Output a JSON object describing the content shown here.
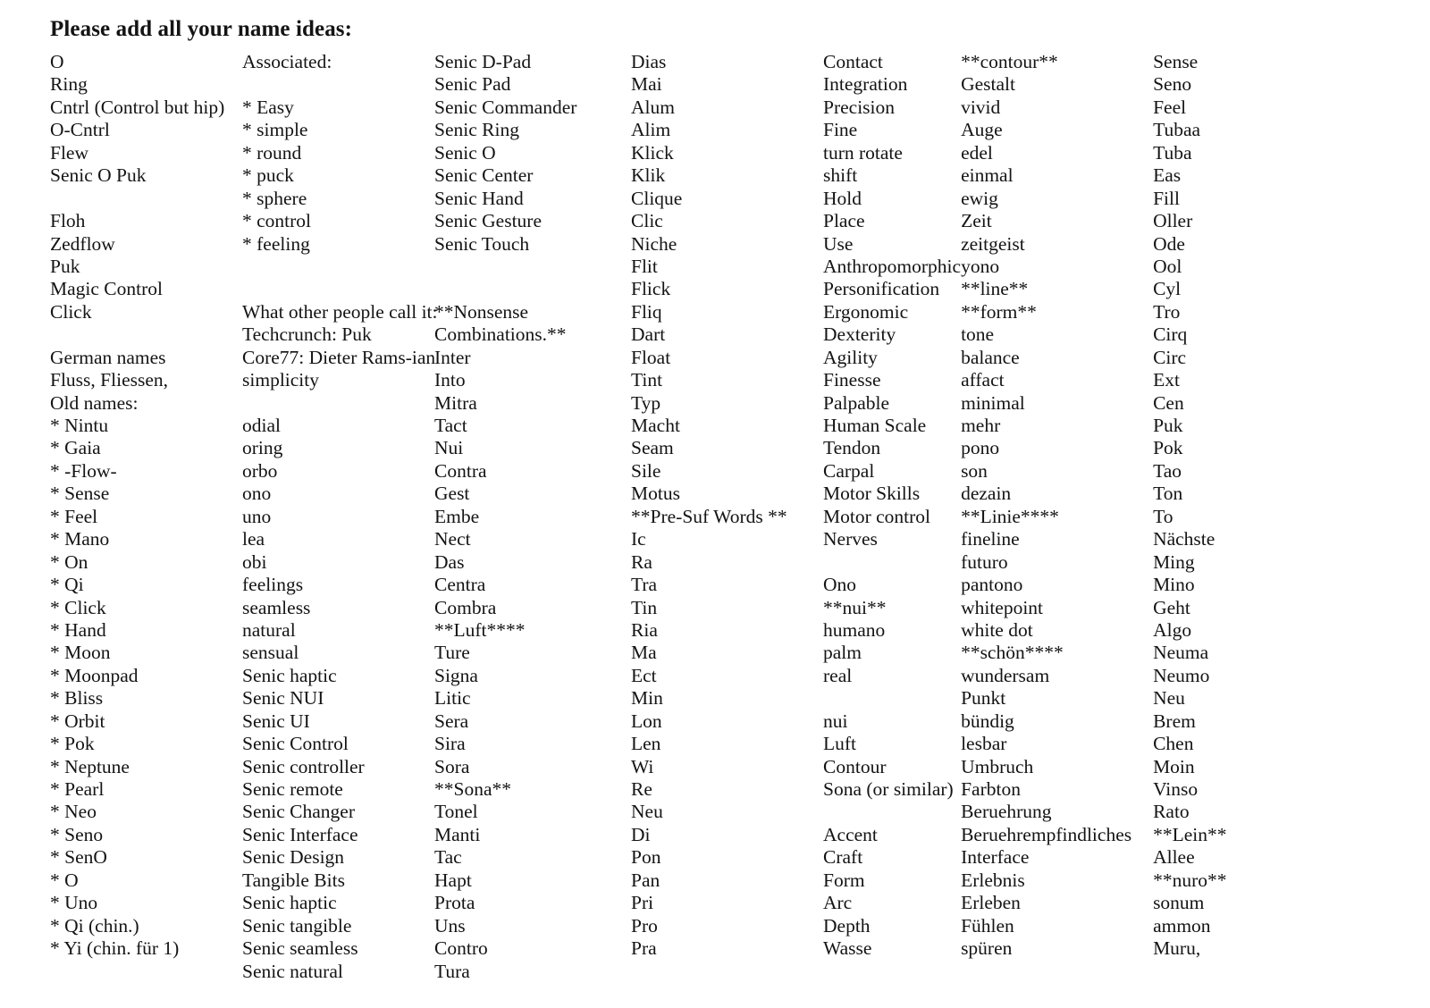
{
  "document": {
    "title": "Please add all your name ideas:"
  },
  "columns": [
    {
      "name": "column-1-core-names",
      "entries": [
        "O",
        "Ring",
        "Cntrl (Control but hip)",
        "O-Cntrl",
        "Flew",
        "Senic O Puk",
        "",
        "Floh",
        "Zedflow",
        "Puk",
        "Magic Control",
        "Click",
        "",
        "German names",
        "Fluss, Fliessen,",
        "Old names:",
        "* Nintu",
        "* Gaia",
        "* -Flow-",
        "* Sense",
        "* Feel",
        "* Mano",
        "* On",
        "* Qi",
        "* Click",
        "* Hand",
        "* Moon",
        "* Moonpad",
        "* Bliss",
        "* Orbit",
        "* Pok",
        "* Neptune",
        "* Pearl",
        "* Neo",
        "* Seno",
        "* SenO",
        "* O",
        "* Uno",
        "* Qi (chin.)",
        "* Yi (chin. für 1)"
      ]
    },
    {
      "name": "column-2-associations",
      "entries": [
        "Associated:",
        "",
        "* Easy",
        "* simple",
        "* round",
        "* puck",
        "* sphere",
        "* control",
        "* feeling",
        "",
        "",
        "What other people call it:",
        "Techcrunch: Puk",
        "Core77: Dieter Rams-ian",
        "simplicity",
        "",
        "odial",
        "oring",
        "orbo",
        "ono",
        "uno",
        "lea",
        "obi",
        "feelings",
        "seamless",
        "natural",
        "sensual",
        "Senic haptic",
        "Senic NUI",
        "Senic UI",
        "Senic Control",
        "Senic controller",
        "Senic remote",
        "Senic Changer",
        "Senic Interface",
        "Senic Design",
        "Tangible Bits",
        "Senic haptic",
        "Senic tangible",
        "Senic seamless",
        "Senic natural"
      ]
    },
    {
      "name": "column-3-senic-variants",
      "entries": [
        "Senic D-Pad",
        "Senic Pad",
        "Senic Commander",
        "Senic Ring",
        "Senic O",
        "Senic Center",
        "Senic Hand",
        "Senic Gesture",
        "Senic Touch",
        "",
        "",
        "**Nonsense",
        "Combinations.**",
        "Inter",
        "Into",
        "Mitra",
        "Tact",
        "Nui",
        "Contra",
        "Gest",
        "Embe",
        "Nect",
        "Das",
        "Centra",
        "Combra",
        "**Luft****",
        "Ture",
        "Signa",
        "Litic",
        "Sera",
        "Sira",
        "Sora",
        "**Sona**",
        "Tonel",
        "Manti",
        "Tac",
        "Hapt",
        "Prota",
        "Uns",
        "Contro",
        "Tura"
      ]
    },
    {
      "name": "column-4-short-syllables",
      "entries": [
        "Dias",
        "Mai",
        "Alum",
        "Alim",
        "Klick",
        "Klik",
        "Clique",
        "Clic",
        "Niche",
        "Flit",
        "Flick",
        "Fliq",
        "Dart",
        "Float",
        "Tint",
        "Typ",
        "Macht",
        "Seam",
        "Sile",
        "Motus",
        "**Pre-Suf Words **",
        "Ic",
        "Ra",
        "Tra",
        "Tin",
        "Ria",
        "Ma",
        "Ect",
        "Min",
        "Lon",
        "Len",
        "Wi",
        "Re",
        "Neu",
        "Di",
        "Pon",
        "Pan",
        "Pri",
        "Pro",
        "Pra"
      ]
    },
    {
      "name": "column-5-qualities",
      "entries": [
        "Contact",
        "Integration",
        "Precision",
        "Fine",
        "turn rotate",
        "shift",
        "Hold",
        "Place",
        "Use",
        "Anthropomorphic",
        "Personification",
        "Ergonomic",
        "Dexterity",
        "Agility",
        "Finesse",
        "Palpable",
        "Human Scale",
        "Tendon",
        "Carpal",
        "Motor Skills",
        "Motor control",
        "Nerves",
        "",
        "Ono",
        "**nui**",
        "humano",
        "palm",
        "real",
        "",
        "nui",
        "Luft",
        "Contour",
        "Sona (or similar)",
        "",
        "Accent",
        "Craft",
        "Form",
        "Arc",
        "Depth",
        "Wasse"
      ]
    },
    {
      "name": "column-6-german-terms",
      "entries": [
        "**contour**",
        "Gestalt",
        "vivid",
        "Auge",
        "edel",
        "einmal",
        "ewig",
        "Zeit",
        "zeitgeist",
        "yono",
        "**line**",
        "**form**",
        "tone",
        " balance",
        "affact",
        "minimal",
        "mehr",
        "pono",
        "son",
        "dezain",
        "**Linie****",
        "fineline",
        "futuro",
        "pantono",
        "whitepoint",
        "white dot",
        "**schön****",
        "wundersam",
        "Punkt",
        "bündig",
        "lesbar",
        "Umbruch",
        "Farbton",
        "Beruehrung",
        "Beruehrempfindliches",
        "Interface",
        "Erlebnis",
        "Erleben",
        "Fühlen",
        "spüren"
      ]
    },
    {
      "name": "column-7-sound-ideas",
      "entries": [
        "Sense",
        "Seno",
        "Feel",
        "Tubaa",
        "Tuba",
        "Eas",
        "Fill",
        "Oller",
        "Ode",
        "Ool",
        "Cyl",
        "Tro",
        "Cirq",
        "Circ",
        "Ext",
        "Cen",
        "Puk",
        "Pok",
        "Tao",
        "Ton",
        "To",
        "Nächste",
        "Ming",
        "Mino",
        "Geht",
        "Algo",
        "Neuma",
        "Neumo",
        "Neu",
        "Brem",
        "Chen",
        "Moin",
        "Vinso",
        "Rato",
        "**Lein**",
        "Allee",
        "**nuro**",
        "sonum",
        "ammon",
        "Muru,"
      ]
    }
  ]
}
